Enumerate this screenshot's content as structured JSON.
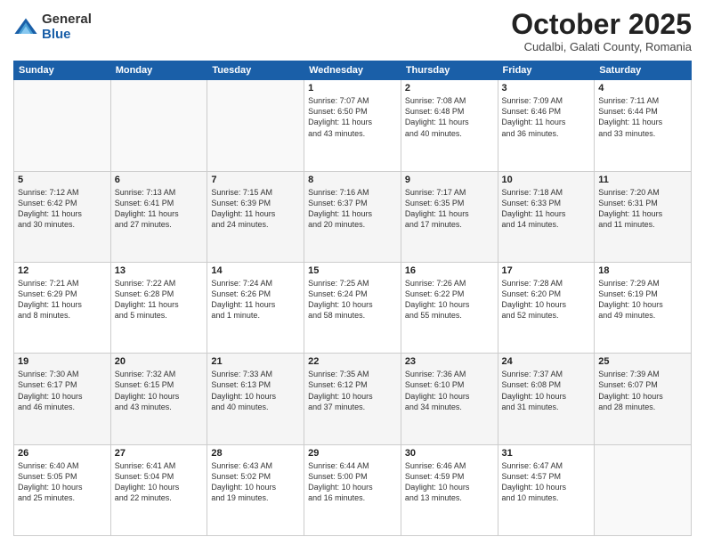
{
  "logo": {
    "general": "General",
    "blue": "Blue"
  },
  "header": {
    "month": "October 2025",
    "location": "Cudalbi, Galati County, Romania"
  },
  "days_of_week": [
    "Sunday",
    "Monday",
    "Tuesday",
    "Wednesday",
    "Thursday",
    "Friday",
    "Saturday"
  ],
  "weeks": [
    [
      {
        "day": "",
        "info": ""
      },
      {
        "day": "",
        "info": ""
      },
      {
        "day": "",
        "info": ""
      },
      {
        "day": "1",
        "info": "Sunrise: 7:07 AM\nSunset: 6:50 PM\nDaylight: 11 hours\nand 43 minutes."
      },
      {
        "day": "2",
        "info": "Sunrise: 7:08 AM\nSunset: 6:48 PM\nDaylight: 11 hours\nand 40 minutes."
      },
      {
        "day": "3",
        "info": "Sunrise: 7:09 AM\nSunset: 6:46 PM\nDaylight: 11 hours\nand 36 minutes."
      },
      {
        "day": "4",
        "info": "Sunrise: 7:11 AM\nSunset: 6:44 PM\nDaylight: 11 hours\nand 33 minutes."
      }
    ],
    [
      {
        "day": "5",
        "info": "Sunrise: 7:12 AM\nSunset: 6:42 PM\nDaylight: 11 hours\nand 30 minutes."
      },
      {
        "day": "6",
        "info": "Sunrise: 7:13 AM\nSunset: 6:41 PM\nDaylight: 11 hours\nand 27 minutes."
      },
      {
        "day": "7",
        "info": "Sunrise: 7:15 AM\nSunset: 6:39 PM\nDaylight: 11 hours\nand 24 minutes."
      },
      {
        "day": "8",
        "info": "Sunrise: 7:16 AM\nSunset: 6:37 PM\nDaylight: 11 hours\nand 20 minutes."
      },
      {
        "day": "9",
        "info": "Sunrise: 7:17 AM\nSunset: 6:35 PM\nDaylight: 11 hours\nand 17 minutes."
      },
      {
        "day": "10",
        "info": "Sunrise: 7:18 AM\nSunset: 6:33 PM\nDaylight: 11 hours\nand 14 minutes."
      },
      {
        "day": "11",
        "info": "Sunrise: 7:20 AM\nSunset: 6:31 PM\nDaylight: 11 hours\nand 11 minutes."
      }
    ],
    [
      {
        "day": "12",
        "info": "Sunrise: 7:21 AM\nSunset: 6:29 PM\nDaylight: 11 hours\nand 8 minutes."
      },
      {
        "day": "13",
        "info": "Sunrise: 7:22 AM\nSunset: 6:28 PM\nDaylight: 11 hours\nand 5 minutes."
      },
      {
        "day": "14",
        "info": "Sunrise: 7:24 AM\nSunset: 6:26 PM\nDaylight: 11 hours\nand 1 minute."
      },
      {
        "day": "15",
        "info": "Sunrise: 7:25 AM\nSunset: 6:24 PM\nDaylight: 10 hours\nand 58 minutes."
      },
      {
        "day": "16",
        "info": "Sunrise: 7:26 AM\nSunset: 6:22 PM\nDaylight: 10 hours\nand 55 minutes."
      },
      {
        "day": "17",
        "info": "Sunrise: 7:28 AM\nSunset: 6:20 PM\nDaylight: 10 hours\nand 52 minutes."
      },
      {
        "day": "18",
        "info": "Sunrise: 7:29 AM\nSunset: 6:19 PM\nDaylight: 10 hours\nand 49 minutes."
      }
    ],
    [
      {
        "day": "19",
        "info": "Sunrise: 7:30 AM\nSunset: 6:17 PM\nDaylight: 10 hours\nand 46 minutes."
      },
      {
        "day": "20",
        "info": "Sunrise: 7:32 AM\nSunset: 6:15 PM\nDaylight: 10 hours\nand 43 minutes."
      },
      {
        "day": "21",
        "info": "Sunrise: 7:33 AM\nSunset: 6:13 PM\nDaylight: 10 hours\nand 40 minutes."
      },
      {
        "day": "22",
        "info": "Sunrise: 7:35 AM\nSunset: 6:12 PM\nDaylight: 10 hours\nand 37 minutes."
      },
      {
        "day": "23",
        "info": "Sunrise: 7:36 AM\nSunset: 6:10 PM\nDaylight: 10 hours\nand 34 minutes."
      },
      {
        "day": "24",
        "info": "Sunrise: 7:37 AM\nSunset: 6:08 PM\nDaylight: 10 hours\nand 31 minutes."
      },
      {
        "day": "25",
        "info": "Sunrise: 7:39 AM\nSunset: 6:07 PM\nDaylight: 10 hours\nand 28 minutes."
      }
    ],
    [
      {
        "day": "26",
        "info": "Sunrise: 6:40 AM\nSunset: 5:05 PM\nDaylight: 10 hours\nand 25 minutes."
      },
      {
        "day": "27",
        "info": "Sunrise: 6:41 AM\nSunset: 5:04 PM\nDaylight: 10 hours\nand 22 minutes."
      },
      {
        "day": "28",
        "info": "Sunrise: 6:43 AM\nSunset: 5:02 PM\nDaylight: 10 hours\nand 19 minutes."
      },
      {
        "day": "29",
        "info": "Sunrise: 6:44 AM\nSunset: 5:00 PM\nDaylight: 10 hours\nand 16 minutes."
      },
      {
        "day": "30",
        "info": "Sunrise: 6:46 AM\nSunset: 4:59 PM\nDaylight: 10 hours\nand 13 minutes."
      },
      {
        "day": "31",
        "info": "Sunrise: 6:47 AM\nSunset: 4:57 PM\nDaylight: 10 hours\nand 10 minutes."
      },
      {
        "day": "",
        "info": ""
      }
    ]
  ]
}
